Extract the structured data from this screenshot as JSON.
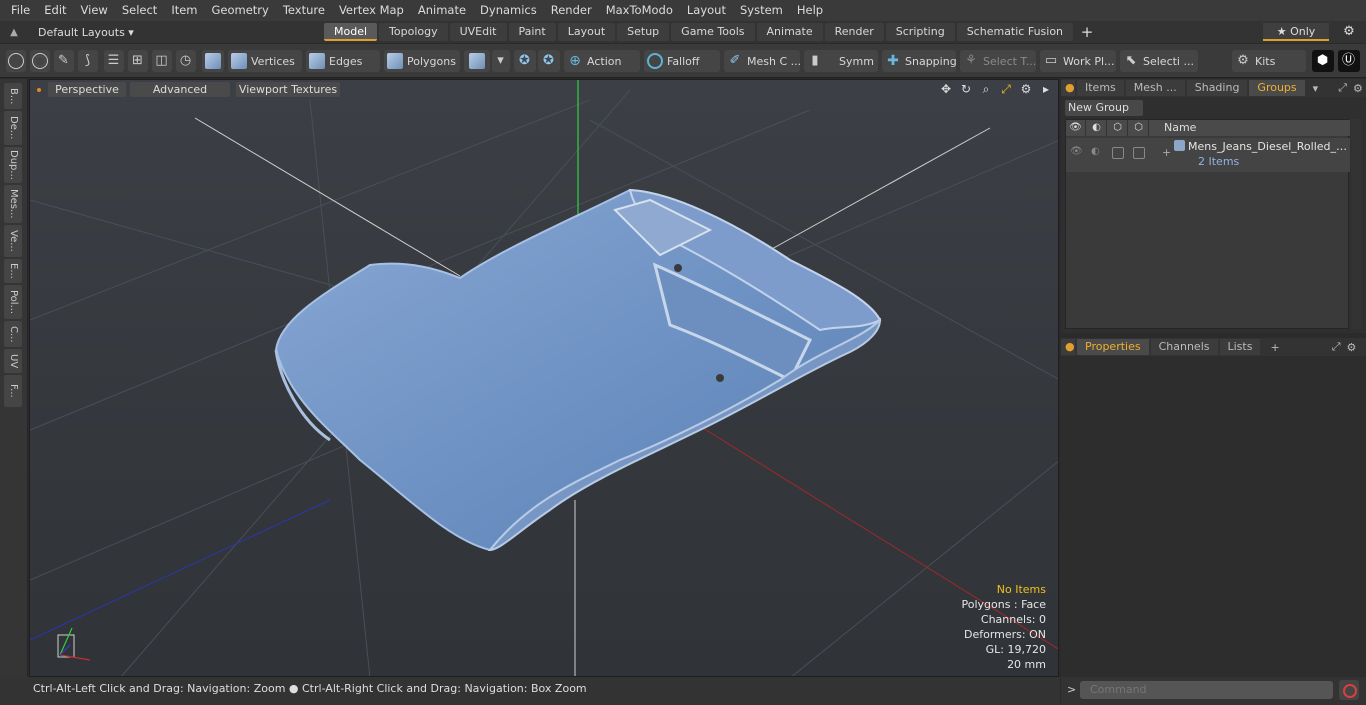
{
  "menu": [
    "File",
    "Edit",
    "View",
    "Select",
    "Item",
    "Geometry",
    "Texture",
    "Vertex Map",
    "Animate",
    "Dynamics",
    "Render",
    "MaxToModo",
    "Layout",
    "System",
    "Help"
  ],
  "layout_dropdown": "Default Layouts ▾",
  "layout_tabs": [
    "Model",
    "Topology",
    "UVEdit",
    "Paint",
    "Layout",
    "Setup",
    "Game Tools",
    "Animate",
    "Render",
    "Scripting",
    "Schematic Fusion"
  ],
  "only_label": "★ Only",
  "toolbar": {
    "vertices": "Vertices",
    "edges": "Edges",
    "polygons": "Polygons",
    "action": "Action",
    "falloff": "Falloff",
    "mesh": "Mesh C ...",
    "symm": "Symm ...",
    "snapping": "Snapping",
    "select_t": "Select T...",
    "work_plane": "Work Pl...",
    "selecti": "Selecti ...",
    "kits": "Kits"
  },
  "left_tabs": [
    "B...",
    "De...",
    "Dup...",
    "Mes...",
    "Ve...",
    "E...",
    "Pol...",
    "C...",
    "UV",
    "F..."
  ],
  "viewport": {
    "perspective": "Perspective",
    "advanced": "Advanced",
    "viewport_textures": "Viewport Textures",
    "info": {
      "no_items": "No Items",
      "polygons": "Polygons : Face",
      "channels": "Channels: 0",
      "deformers": "Deformers: ON",
      "gl": "GL: 19,720",
      "scale": "20 mm"
    }
  },
  "status": "Ctrl-Alt-Left Click and Drag: Navigation: Zoom ● Ctrl-Alt-Right Click and Drag: Navigation: Box Zoom",
  "right_panel": {
    "tabs": [
      "Items",
      "Mesh ...",
      "Shading",
      "Groups"
    ],
    "active_tab": "Groups",
    "new_group": "New Group",
    "name_header": "Name",
    "group_name": "Mens_Jeans_Diesel_Rolled_Bl...",
    "group_count": "2 Items"
  },
  "bottom_panel": {
    "tabs": [
      "Properties",
      "Channels",
      "Lists"
    ],
    "active_tab": "Properties"
  },
  "command_placeholder": "Command",
  "colors": {
    "accent": "#e0a030",
    "jeans": "#6f93c4",
    "axis_x": "#b03030",
    "axis_y": "#30d040",
    "axis_z": "#3040c0"
  }
}
